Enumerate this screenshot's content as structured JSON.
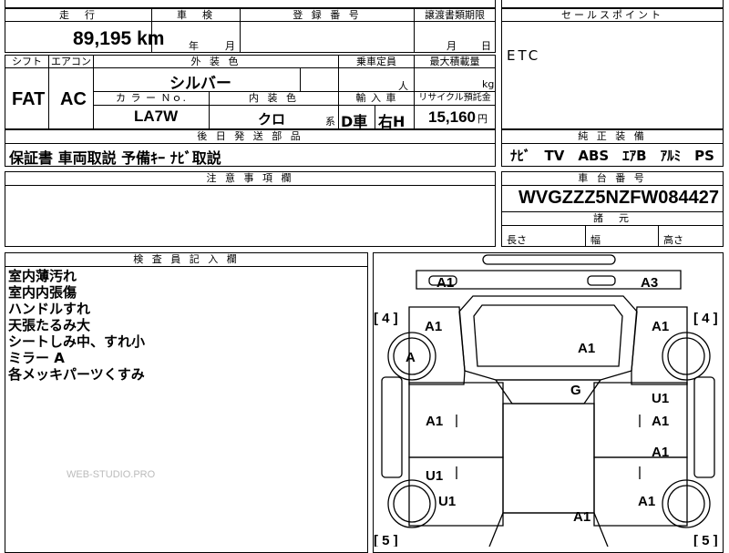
{
  "header": {
    "mileage_label": "走　行",
    "mileage_value": "89,195",
    "mileage_unit": "km",
    "inspection_label": "車　検",
    "inspection_year_unit": "年",
    "inspection_month_unit": "月",
    "registration_label": "登 録 番 号",
    "transfer_label": "譲渡書類期限",
    "transfer_month_unit": "月",
    "transfer_day_unit": "日"
  },
  "sales_point": {
    "label": "セールスポイント",
    "text": "ETC"
  },
  "specs": {
    "shift_label": "シフト",
    "shift_value": "FAT",
    "aircon_label": "エアコン",
    "aircon_value": "AC",
    "exterior_label": "外 装 色",
    "exterior_value": "シルバー",
    "capacity_label": "乗車定員",
    "capacity_unit": "人",
    "load_label": "最大積載量",
    "load_unit": "kg",
    "color_no_label": "カ ラ ー Ｎｏ.",
    "color_no_value": "LA7W",
    "interior_label": "内 装 色",
    "interior_value": "クロ",
    "interior_suffix": "系",
    "import_label": "輸 入 車",
    "import_value_1": "D車",
    "import_value_2": "右H",
    "recycle_label": "リサイクル預託金",
    "recycle_value": "15,160",
    "recycle_unit": "円"
  },
  "accessories": {
    "label": "後 日 発 送 部 品",
    "text": "保証書 車両取説 予備ｷｰ ﾅﾋﾞ取説"
  },
  "equipment": {
    "label": "純 正 装 備",
    "text": "ﾅﾋﾞ　TV　ABS　ｴｱB　ｱﾙﾐ　PS　PW"
  },
  "notes": {
    "label": "注 意 事 項 欄"
  },
  "chassis": {
    "label": "車 台 番 号",
    "value": "WVGZZZ5NZFW084427"
  },
  "dims": {
    "label": "諸　元",
    "length": "長さ",
    "width": "幅",
    "height": "高さ"
  },
  "inspector": {
    "label": "検 査 員 記 入 欄",
    "lines": [
      "室内薄汚れ",
      "室内内張傷",
      "ハンドルすれ",
      "天張たるみ大",
      "シートしみ中、すれ小",
      "ミラー A",
      "各メッキパーツくすみ"
    ]
  },
  "watermark": "WEB-STUDIO.PRO",
  "diagram": {
    "tire_fl": "[ 4 ]",
    "tire_fr": "[ 4 ]",
    "tire_rl": "[ 5 ]",
    "tire_rr": "[ 5 ]",
    "marks": [
      "A1",
      "A3",
      "A1",
      "A1",
      "A1",
      "A",
      "G",
      "U1",
      "A1",
      "A1",
      "A1",
      "U1",
      "U1",
      "A1",
      "A1"
    ]
  },
  "colors": {
    "line": "#000000",
    "watermark": "#bbbbbb"
  }
}
